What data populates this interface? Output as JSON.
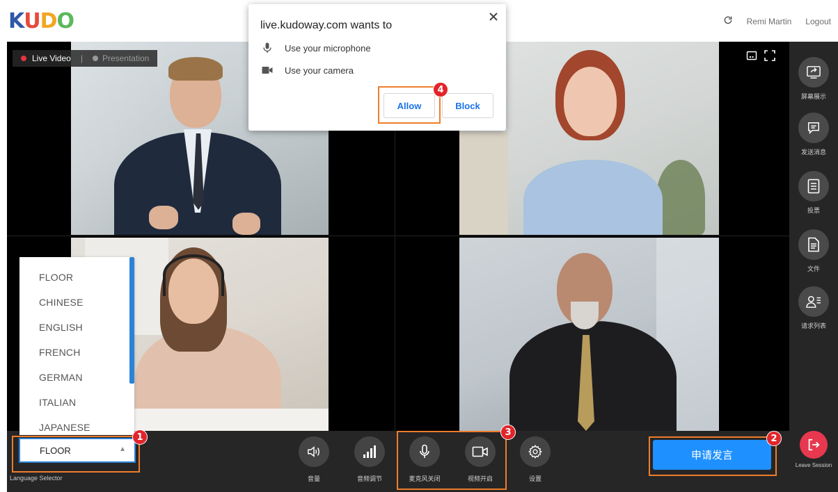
{
  "header": {
    "logo": [
      "K",
      "U",
      "D",
      "O"
    ],
    "logo_colors": [
      "#2f57a8",
      "#e64a3c",
      "#f2a623",
      "#5cb85c"
    ],
    "user_name": "Remi Martin",
    "logout_label": "Logout",
    "refresh_icon": "refresh-icon"
  },
  "stage": {
    "live_tab": "Live Video",
    "separator": "|",
    "presentation_tab": "Presentation",
    "live_dot_color": "#e5343d"
  },
  "sidebar": {
    "items": [
      {
        "label": "屏幕展示",
        "icon": "screen-share-icon"
      },
      {
        "label": "发送消息",
        "icon": "chat-icon"
      },
      {
        "label": "投票",
        "icon": "poll-icon"
      },
      {
        "label": "文件",
        "icon": "document-icon"
      },
      {
        "label": "请求列表",
        "icon": "request-list-icon"
      }
    ],
    "leave_label": "Leave Session"
  },
  "bottom": {
    "language_value": "FLOOR",
    "language_caption": "Language Selector",
    "controls": [
      {
        "label": "音量",
        "icon": "volume-icon"
      },
      {
        "label": "音频调节",
        "icon": "audio-levels-icon"
      },
      {
        "label": "麦克风关闭",
        "icon": "microphone-icon"
      },
      {
        "label": "视频开启",
        "icon": "camera-icon"
      },
      {
        "label": "设置",
        "icon": "gear-icon"
      }
    ],
    "speak_button": "申请发言"
  },
  "language_dropdown": {
    "options": [
      "FLOOR",
      "CHINESE",
      "ENGLISH",
      "FRENCH",
      "GERMAN",
      "ITALIAN",
      "JAPANESE"
    ]
  },
  "permission_popup": {
    "title": "live.kudoway.com wants to",
    "permissions": [
      "Use your microphone",
      "Use your camera"
    ],
    "allow_label": "Allow",
    "block_label": "Block"
  },
  "annotations": [
    "1",
    "2",
    "3",
    "4"
  ],
  "colors": {
    "accent_blue": "#1e90ff",
    "annotation_orange": "#ef7d2b",
    "badge_red": "#e1252b",
    "leave_red": "#e7384f"
  }
}
